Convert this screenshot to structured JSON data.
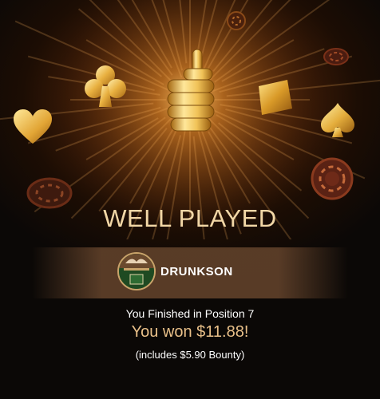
{
  "result": {
    "title": "WELL PLAYED",
    "player_name": "DRUNKSON",
    "position_text": "You Finished in Position 7",
    "won_text": "You won $11.88!",
    "bounty_text": "(includes $5.90 Bounty)"
  },
  "icons": {
    "hero": "thumbs-up-icon",
    "suits": [
      "club-icon",
      "heart-icon",
      "diamond-icon",
      "spade-icon"
    ],
    "chips": "poker-chip-icon"
  },
  "colors": {
    "gold": "#e9b048",
    "title": "#f2d7a6",
    "won": "#e9c089",
    "strip": "#5c3e28",
    "background": "#0b0806"
  }
}
